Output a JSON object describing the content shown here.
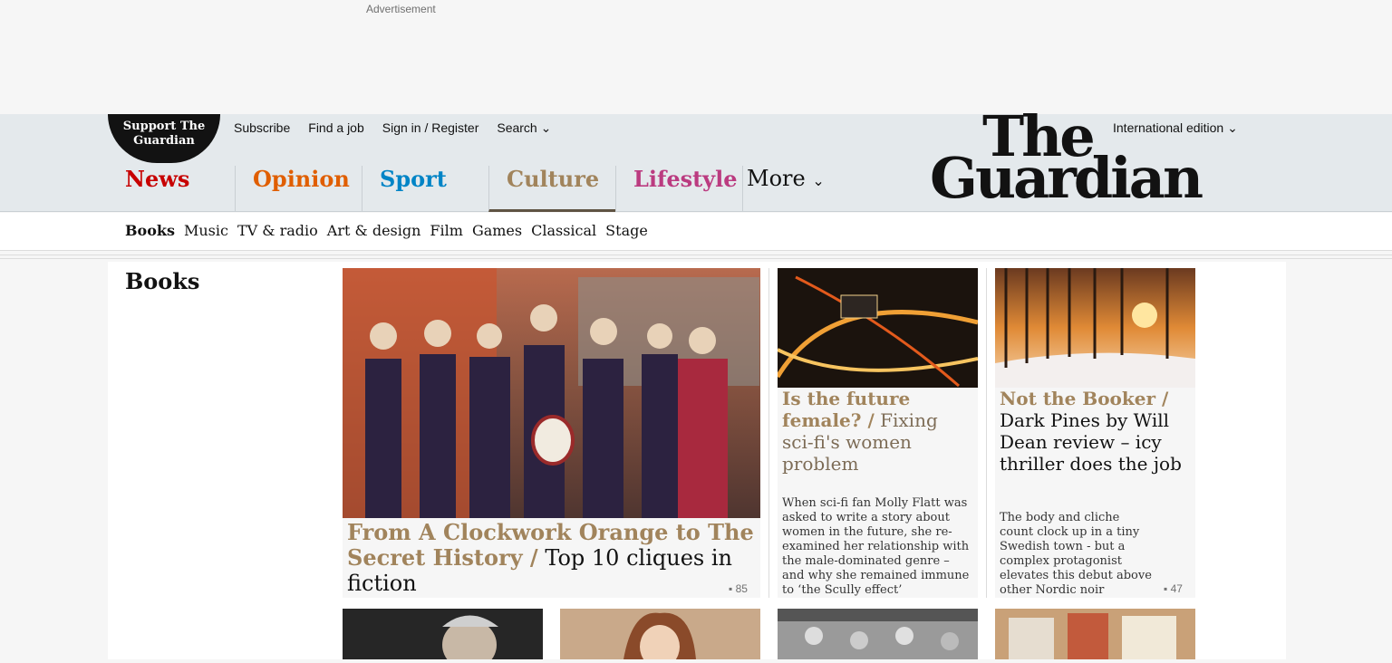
{
  "ad": {
    "label": "Advertisement"
  },
  "header": {
    "support": "Support The Guardian",
    "links": [
      "Subscribe",
      "Find a job",
      "Sign in / Register",
      "Search"
    ],
    "edition": "International edition",
    "logo_line1": "The",
    "logo_line2": "Guardian"
  },
  "pillars": [
    {
      "label": "News",
      "color": "#c70000"
    },
    {
      "label": "Opinion",
      "color": "#e05e00"
    },
    {
      "label": "Sport",
      "color": "#0084c6"
    },
    {
      "label": "Culture",
      "color": "#a1845c"
    },
    {
      "label": "Lifestyle",
      "color": "#bb3b80"
    },
    {
      "label": "More",
      "color": "#121212"
    }
  ],
  "subnav": [
    "Books",
    "Music",
    "TV & radio",
    "Art & design",
    "Film",
    "Games",
    "Classical",
    "Stage"
  ],
  "section": {
    "title": "Books"
  },
  "cards": [
    {
      "kicker": "From A Clockwork Orange to The Secret History /",
      "headline": "Top 10 cliques in fiction",
      "comments": "85"
    },
    {
      "kicker": "Is the future female? /",
      "headline": "Fixing sci-fi's women problem",
      "standfirst": "When sci-fi fan Molly Flatt was asked to write a story about women in the future, she re-examined her relationship with the male-dominated genre – and why she remained immune to ‘the Scully effect’"
    },
    {
      "kicker": "Not the Booker /",
      "headline": "Dark Pines by Will Dean review – icy thriller does the job",
      "standfirst": "The body and cliche count clock up in a tiny Swedish town - but a complex protagonist elevates this debut above other Nordic noir",
      "comments": "47"
    }
  ],
  "colors": {
    "culture_accent": "#a1845c",
    "header_bg": "#e4e9ec"
  }
}
